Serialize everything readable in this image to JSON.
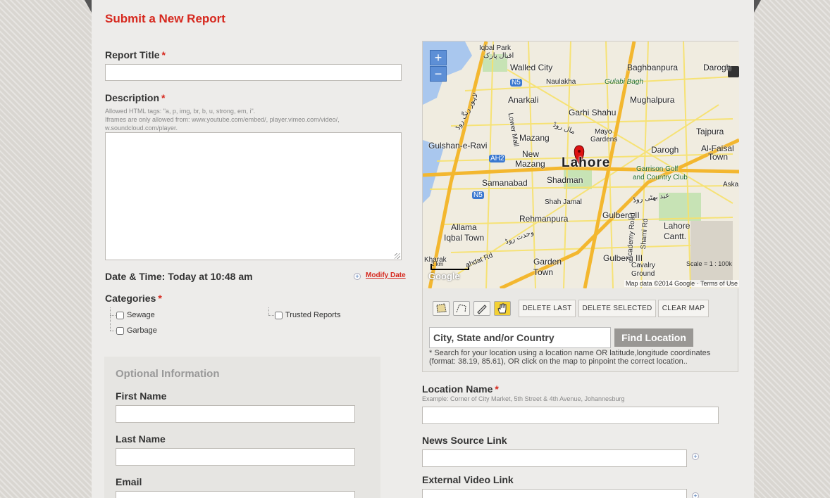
{
  "page": {
    "title": "Submit a New Report"
  },
  "form": {
    "report_title": {
      "label": "Report Title",
      "required": "*",
      "value": ""
    },
    "description": {
      "label": "Description",
      "required": "*",
      "hint_line1": "Allowed HTML tags: \"a, p, img, br, b, u, strong, em, i\".",
      "hint_line2": "Iframes are only allowed from: www.youtube.com/embed/, player.vimeo.com/video/,",
      "hint_line3": "w.soundcloud.com/player.",
      "value": ""
    },
    "datetime": {
      "text": "Date & Time: Today at 10:48 am",
      "modify_label": "Modify Date"
    },
    "categories": {
      "label": "Categories",
      "required": "*",
      "items": [
        {
          "label": "Sewage",
          "checked": false
        },
        {
          "label": "Garbage",
          "checked": false
        },
        {
          "label": "Trusted Reports",
          "checked": false
        }
      ]
    },
    "optional": {
      "title": "Optional Information",
      "first_name": {
        "label": "First Name",
        "value": ""
      },
      "last_name": {
        "label": "Last Name",
        "value": ""
      },
      "email": {
        "label": "Email",
        "value": ""
      }
    },
    "location_name": {
      "label": "Location Name",
      "required": "*",
      "hint": "Example: Corner of City Market, 5th Street & 4th Avenue, Johannesburg",
      "value": ""
    },
    "news_source": {
      "label": "News Source Link",
      "value": ""
    },
    "external_video": {
      "label": "External Video Link",
      "value": ""
    }
  },
  "map": {
    "zoom_in": "+",
    "zoom_out": "−",
    "labels": {
      "iqbal_park": "Iqbal Park",
      "iqbal_park_urdu": "اقبال پارک",
      "walled_city": "Walled City",
      "baghbanpura": "Baghbanpura",
      "darogh": "Darogh",
      "naulakha": "Naulakha",
      "gulabi_bagh": "Gulabi Bagh",
      "anarkali": "Anarkali",
      "mughalpura": "Mughalpura",
      "garhi_shahu": "Garhi Shahu",
      "n5a": "N5",
      "mayo": "Mayo",
      "gardens": "Gardens",
      "tajpura": "Tajpura",
      "mazang": "Mazang",
      "gulshan": "Gulshan-e-Ravi",
      "new": "New",
      "mazang2": "Mazang",
      "lahore": "Lahore",
      "al_faisal": "Al-Faisal",
      "town": "Town",
      "ah2": "AH2",
      "garrison": "Garrison Golf",
      "country_club": "and Country Club",
      "samanabad": "Samanabad",
      "shadman": "Shadman",
      "aska": "Aska",
      "n5b": "N5",
      "shah_jamal": "Shah Jamal",
      "gulberg2": "Gulberg II",
      "rehmanpura": "Rehmanpura",
      "lahore_cantt": "Lahore",
      "cantt": "Cantt.",
      "allama": "Allama",
      "iqbal_town": "Iqbal Town",
      "gulberg3": "Gulberg III",
      "kharak": "Kharak",
      "garden": "Garden",
      "garden_town": "Town",
      "cavalry": "Cavalry",
      "ground": "Ground",
      "ferozpur_urdu": "لاہور رنگ روڈ",
      "mall_urdu": "مال روڈ",
      "wahdat_urdu": "وحدت روڈ",
      "abid_urdu": "عبد بھٹی روڈ",
      "lower_mall": "Lower Mall",
      "academy_road": "Academy Road",
      "shami_rd": "Shami Rd",
      "wahdat_rd": "ahdat Rd"
    },
    "scale_left": "2 km",
    "scale_right": "Scale = 1 : 100k",
    "google": "Google",
    "attribution": "Map data ©2014 Google · Terms of Use"
  },
  "map_tools": {
    "delete_last": "DELETE LAST",
    "delete_selected": "DELETE SELECTED",
    "clear_map": "CLEAR MAP"
  },
  "location_search": {
    "placeholder": "City, State and/or Country",
    "button": "Find Location",
    "hint": "* Search for your location using a location name OR latitude,longitude coordinates (format: 38.19, 85.61), OR click on the map to pinpoint the correct location.."
  },
  "colors": {
    "accent": "#d6281e",
    "map_road": "#f6d64a",
    "map_major": "#f3b72f"
  }
}
